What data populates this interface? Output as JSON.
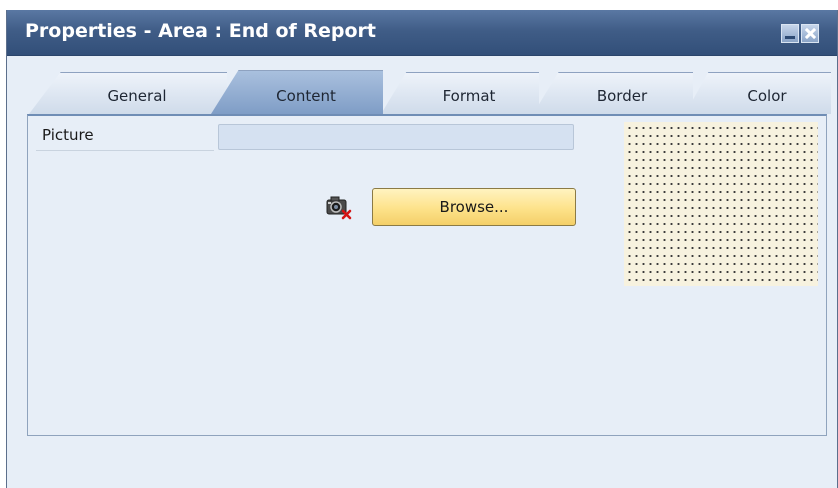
{
  "window": {
    "title": "Properties - Area : End of Report"
  },
  "tabs": [
    {
      "label": "General",
      "active": false
    },
    {
      "label": "Content",
      "active": true
    },
    {
      "label": "Format",
      "active": false
    },
    {
      "label": "Border",
      "active": false
    },
    {
      "label": "Color",
      "active": false
    }
  ],
  "content": {
    "picture_label": "Picture",
    "picture_value": "",
    "browse_label": "Browse..."
  },
  "icons": {
    "minimize": "minimize-icon",
    "close": "close-icon",
    "camera": "camera-remove-icon"
  },
  "colors": {
    "title_bar": "#405d87",
    "panel_background": "#e7eef7",
    "browse_button": "#fde28a",
    "active_tab": "#8ea9cf"
  }
}
